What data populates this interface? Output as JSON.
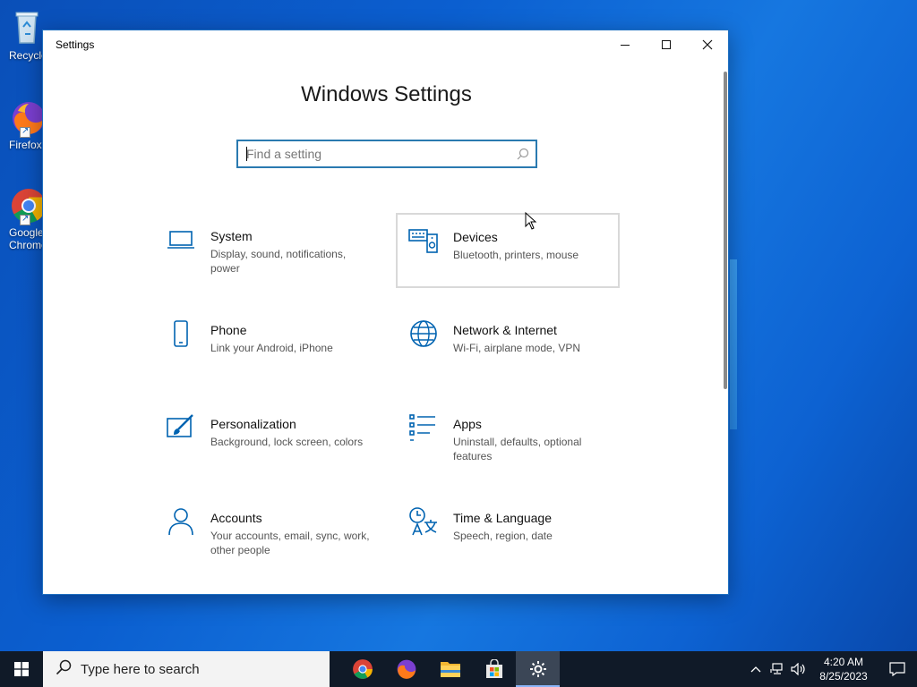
{
  "desktop": {
    "icons": [
      {
        "label": "Recycle",
        "icon": "recycle-bin-icon"
      },
      {
        "label": "Firefox",
        "icon": "firefox-icon"
      },
      {
        "label": "Google Chrome",
        "icon": "chrome-icon"
      }
    ]
  },
  "window": {
    "title": "Settings",
    "heading": "Windows Settings",
    "search_placeholder": "Find a setting",
    "accent": "#0063b1"
  },
  "tiles": [
    {
      "name": "System",
      "desc": "Display, sound, notifications, power",
      "icon": "laptop-icon"
    },
    {
      "name": "Devices",
      "desc": "Bluetooth, printers, mouse",
      "icon": "devices-icon"
    },
    {
      "name": "Phone",
      "desc": "Link your Android, iPhone",
      "icon": "phone-icon"
    },
    {
      "name": "Network & Internet",
      "desc": "Wi-Fi, airplane mode, VPN",
      "icon": "globe-icon"
    },
    {
      "name": "Personalization",
      "desc": "Background, lock screen, colors",
      "icon": "paintbrush-icon"
    },
    {
      "name": "Apps",
      "desc": "Uninstall, defaults, optional features",
      "icon": "apps-list-icon"
    },
    {
      "name": "Accounts",
      "desc": "Your accounts, email, sync, work, other people",
      "icon": "person-icon"
    },
    {
      "name": "Time & Language",
      "desc": "Speech, region, date",
      "icon": "time-language-icon"
    }
  ],
  "taskbar": {
    "search_placeholder": "Type here to search",
    "apps": [
      "chrome-icon",
      "firefox-icon",
      "file-explorer-icon",
      "store-icon",
      "settings-gear-icon"
    ],
    "time": "4:20 AM",
    "date": "8/25/2023"
  }
}
